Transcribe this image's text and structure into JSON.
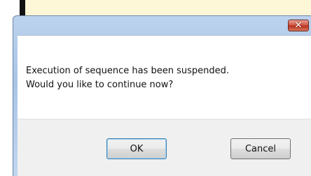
{
  "dialog": {
    "close_glyph": "✕",
    "message_line1": "Execution of sequence has been suspended.",
    "message_line2": "Would you like to continue now?",
    "ok_label": "OK",
    "cancel_label": "Cancel"
  },
  "colors": {
    "titlebar": "#bcd3ee",
    "close_button": "#cf5a47",
    "footer": "#f0f0f0",
    "background_window": "#fdf7d8"
  },
  "icons": {
    "close": "close-icon"
  }
}
